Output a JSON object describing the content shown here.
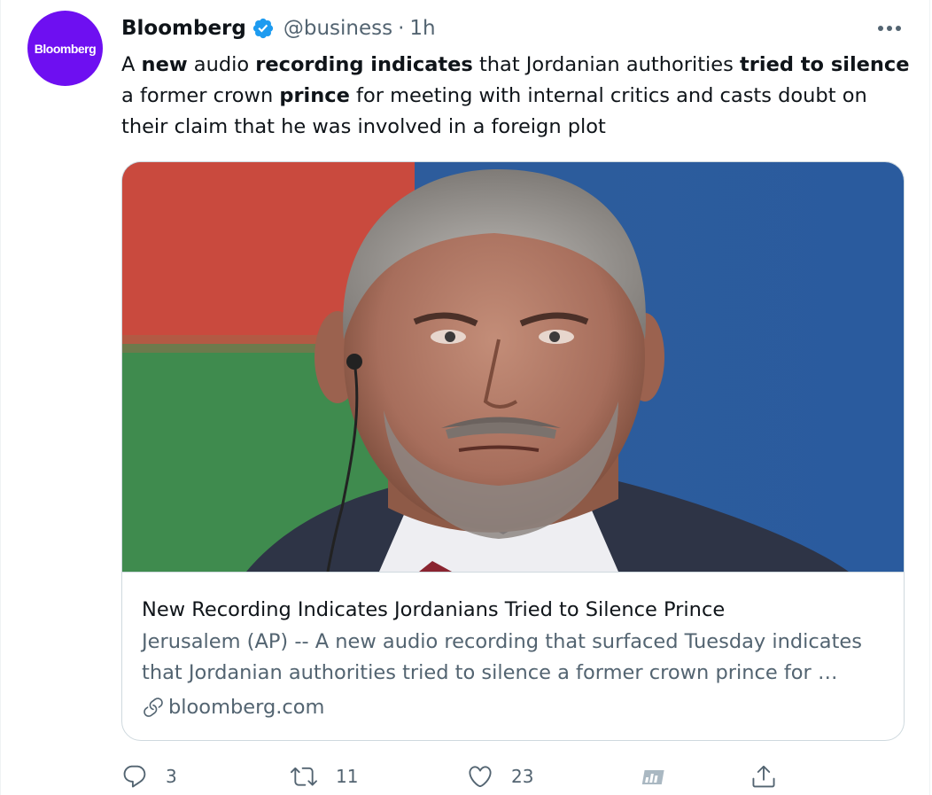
{
  "account": {
    "avatar_text": "Bloomberg",
    "name": "Bloomberg",
    "handle": "@business",
    "separator": "·",
    "time": "1h",
    "verified_icon": "verified-badge-icon",
    "brand_color": "#6e0ff1"
  },
  "tweet": {
    "segments": [
      {
        "text": "A ",
        "bold": false
      },
      {
        "text": "new",
        "bold": true
      },
      {
        "text": " audio ",
        "bold": false
      },
      {
        "text": "recording indicates",
        "bold": true
      },
      {
        "text": " that Jordanian authorities ",
        "bold": false
      },
      {
        "text": "tried to silence",
        "bold": true
      },
      {
        "text": " a former crown ",
        "bold": false
      },
      {
        "text": "prince",
        "bold": true
      },
      {
        "text": " for meeting with internal critics and casts doubt on their claim that he was involved in a foreign plot",
        "bold": false
      }
    ]
  },
  "card": {
    "title": "New Recording Indicates Jordanians Tried to Silence Prince",
    "description": "Jerusalem (AP) -- A new audio recording that surfaced Tuesday indicates that Jordanian authorities tried to silence a former crown prince for …",
    "domain": "bloomberg.com",
    "link_icon": "link-icon"
  },
  "actions": {
    "reply": {
      "icon": "reply-icon",
      "count": "3"
    },
    "retweet": {
      "icon": "retweet-icon",
      "count": "11"
    },
    "like": {
      "icon": "heart-icon",
      "count": "23"
    },
    "analytics": {
      "icon": "analytics-icon"
    },
    "share": {
      "icon": "share-icon"
    }
  },
  "colors": {
    "text_primary": "#0f1419",
    "text_secondary": "#536471",
    "verified_blue": "#1d9bf0",
    "border": "#cfd9de"
  }
}
